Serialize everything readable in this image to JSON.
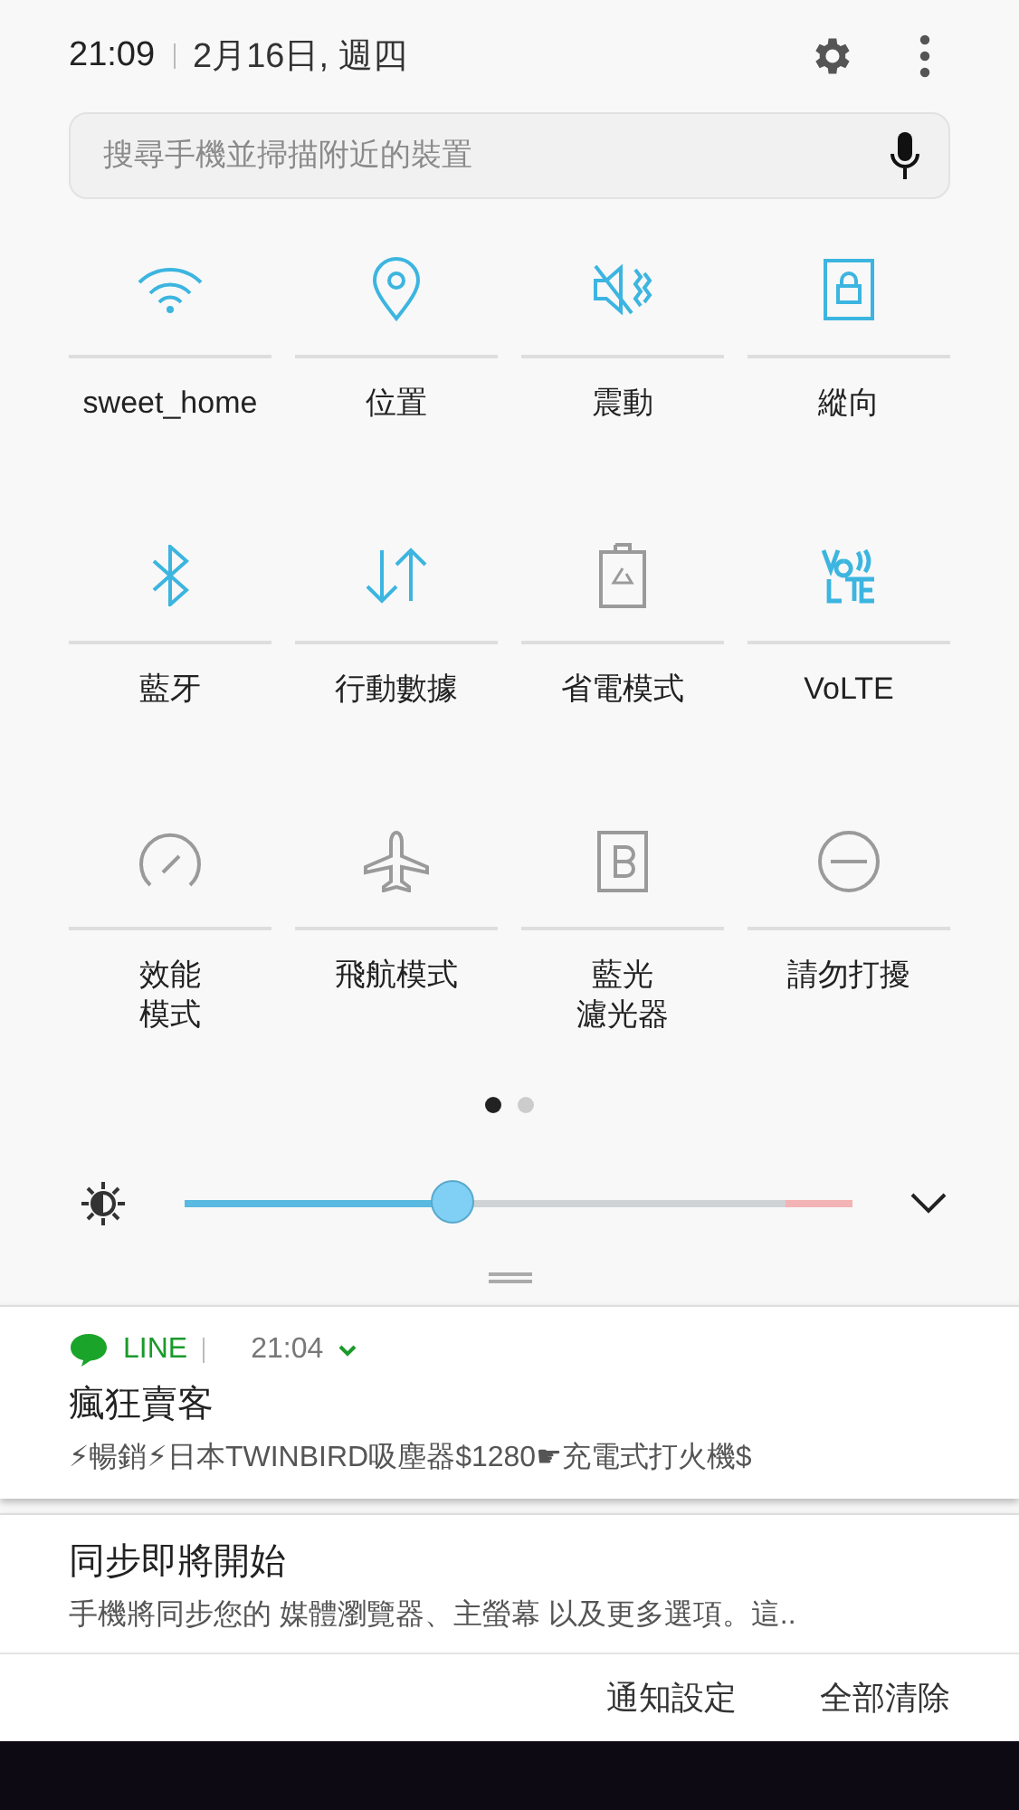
{
  "header": {
    "time": "21:09",
    "date": "2月16日, 週四"
  },
  "search": {
    "placeholder": "搜尋手機並掃描附近的裝置"
  },
  "tiles": [
    {
      "kind": "wifi",
      "label": "sweet_home",
      "on": true
    },
    {
      "kind": "location",
      "label": "位置",
      "on": true
    },
    {
      "kind": "vibrate",
      "label": "震動",
      "on": true
    },
    {
      "kind": "portrait",
      "label": "縱向",
      "on": true
    },
    {
      "kind": "bluetooth",
      "label": "藍牙",
      "on": true
    },
    {
      "kind": "data",
      "label": "行動數據",
      "on": true
    },
    {
      "kind": "battery",
      "label": "省電模式",
      "on": false
    },
    {
      "kind": "volte",
      "label": "VoLTE",
      "on": true
    },
    {
      "kind": "gauge",
      "label": [
        "效能",
        "模式"
      ],
      "on": false
    },
    {
      "kind": "airplane",
      "label": "飛航模式",
      "on": false
    },
    {
      "kind": "bluelight",
      "label": [
        "藍光",
        "濾光器"
      ],
      "on": false
    },
    {
      "kind": "dnd",
      "label": "請勿打擾",
      "on": false
    }
  ],
  "pages": [
    {
      "selected": true
    },
    {
      "selected": false
    }
  ],
  "brightness": {
    "level": 0.4
  },
  "notifications": [
    {
      "kind": "app",
      "app": "LINE",
      "time": "21:04",
      "title": "瘋狂賣客",
      "body": "⚡暢銷⚡日本TWINBIRD吸塵器$1280☛充電式打火機$"
    },
    {
      "kind": "system",
      "title": "同步即將開始",
      "body": "手機將同步您的 媒體瀏覽器、主螢幕 以及更多選項。這.."
    }
  ],
  "actions": [
    "通知設定",
    "全部清除"
  ]
}
